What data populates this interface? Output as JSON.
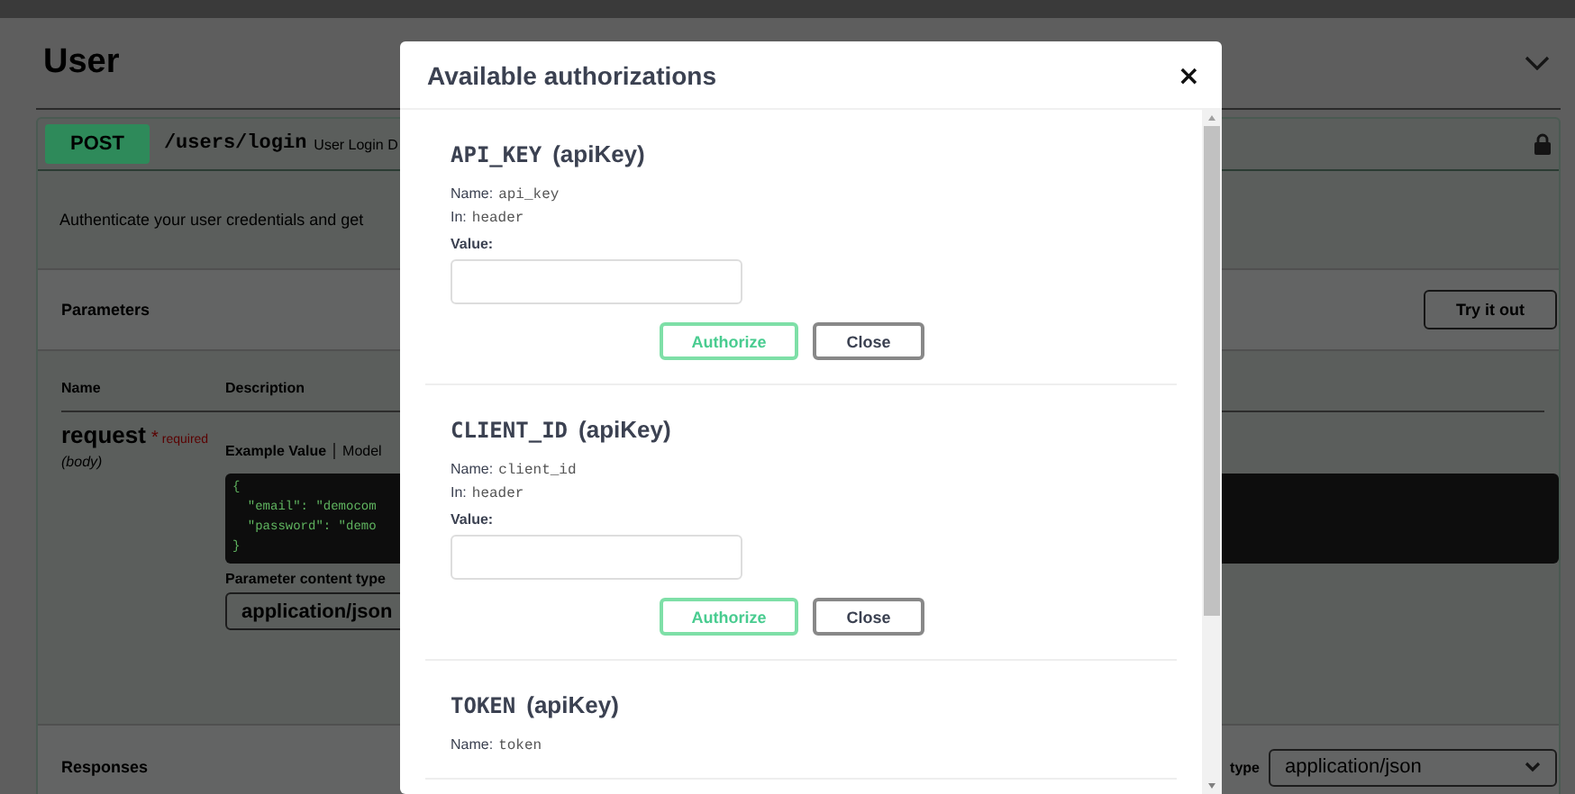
{
  "page": {
    "tag_title": "User",
    "operation": {
      "method": "POST",
      "path": "/users/login",
      "summary": "User Login D"
    },
    "description": "Authenticate your user credentials and get",
    "parameters_heading": "Parameters",
    "try_button": "Try it out",
    "columns": [
      "Name",
      "Description"
    ],
    "param": {
      "name": "request",
      "required_mark": "*",
      "required_label": "required",
      "location": "(body)"
    },
    "example_tabs": [
      {
        "label": "Example Value",
        "selected": true
      },
      {
        "label": "Model",
        "selected": false
      }
    ],
    "code_lines": [
      "{",
      "  \"email\": \"democom",
      "  \"password\": \"demo",
      "}"
    ],
    "content_type_label": "Parameter content type",
    "content_type_value": "application/json",
    "responses_heading": "Responses",
    "response_type_label": "type",
    "response_type_value": "application/json"
  },
  "modal": {
    "title": "Available authorizations",
    "close": "×",
    "schemes": [
      {
        "title": "API_KEY",
        "type": "(apiKey)",
        "name_label": "Name:",
        "name_value": "api_key",
        "in_label": "In:",
        "in_value": "header",
        "value_label": "Value:",
        "buttons": [
          "Authorize",
          "Close"
        ]
      },
      {
        "title": "CLIENT_ID",
        "type": "(apiKey)",
        "name_label": "Name:",
        "name_value": "client_id",
        "in_label": "In:",
        "in_value": "header",
        "value_label": "Value:",
        "buttons": [
          "Authorize",
          "Close"
        ]
      },
      {
        "title": "TOKEN",
        "type": "(apiKey)",
        "name_label": "Name:",
        "name_value": "token"
      }
    ]
  }
}
